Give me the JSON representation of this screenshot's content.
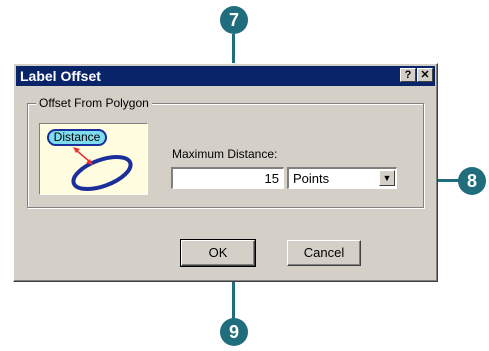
{
  "dialog": {
    "title": "Label Offset",
    "help_button": "?",
    "close_button": "✕"
  },
  "group": {
    "label": "Offset From Polygon",
    "preview_label": "Distance"
  },
  "form": {
    "max_distance_label": "Maximum Distance:",
    "max_distance_value": "15",
    "units_value": "Points"
  },
  "buttons": {
    "ok": "OK",
    "cancel": "Cancel"
  },
  "callouts": [
    "7",
    "8",
    "9"
  ],
  "colors": {
    "titlebar": "#0a246a",
    "callout": "#1f6d7d",
    "pill_fill": "#7ddcf0",
    "polygon_outline": "#1a2f9a",
    "arrow": "#e83030"
  }
}
